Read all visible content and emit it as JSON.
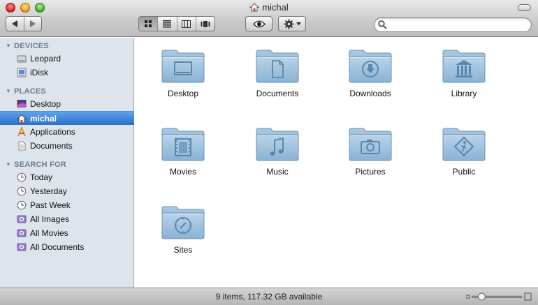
{
  "window": {
    "title": "michal"
  },
  "toolbar": {
    "back_label": "◀",
    "forward_label": "▶"
  },
  "search": {
    "value": "",
    "placeholder": ""
  },
  "sidebar": {
    "sections": [
      {
        "header": "DEVICES",
        "items": [
          {
            "label": "Leopard",
            "icon": "hard-drive-icon"
          },
          {
            "label": "iDisk",
            "icon": "idisk-icon"
          }
        ]
      },
      {
        "header": "PLACES",
        "items": [
          {
            "label": "Desktop",
            "icon": "desktop-icon"
          },
          {
            "label": "michal",
            "icon": "home-icon",
            "selected": true
          },
          {
            "label": "Applications",
            "icon": "applications-icon"
          },
          {
            "label": "Documents",
            "icon": "document-icon"
          }
        ]
      },
      {
        "header": "SEARCH FOR",
        "items": [
          {
            "label": "Today",
            "icon": "clock-icon"
          },
          {
            "label": "Yesterday",
            "icon": "clock-icon"
          },
          {
            "label": "Past Week",
            "icon": "clock-icon"
          },
          {
            "label": "All Images",
            "icon": "smart-folder-icon"
          },
          {
            "label": "All Movies",
            "icon": "smart-folder-icon"
          },
          {
            "label": "All Documents",
            "icon": "smart-folder-icon"
          }
        ]
      }
    ]
  },
  "folders": [
    {
      "label": "Desktop",
      "icon": "desktop-folder-icon"
    },
    {
      "label": "Documents",
      "icon": "documents-folder-icon"
    },
    {
      "label": "Downloads",
      "icon": "downloads-folder-icon"
    },
    {
      "label": "Library",
      "icon": "library-folder-icon"
    },
    {
      "label": "Movies",
      "icon": "movies-folder-icon"
    },
    {
      "label": "Music",
      "icon": "music-folder-icon"
    },
    {
      "label": "Pictures",
      "icon": "pictures-folder-icon"
    },
    {
      "label": "Public",
      "icon": "public-folder-icon"
    },
    {
      "label": "Sites",
      "icon": "sites-folder-icon"
    }
  ],
  "status": {
    "text": "9 items, 117.32 GB available",
    "icon_size_level": 0.2
  },
  "colors": {
    "sidebar_bg": "#dde4ec",
    "selection": "#2a70c9",
    "folder": "#8fb6d6"
  }
}
